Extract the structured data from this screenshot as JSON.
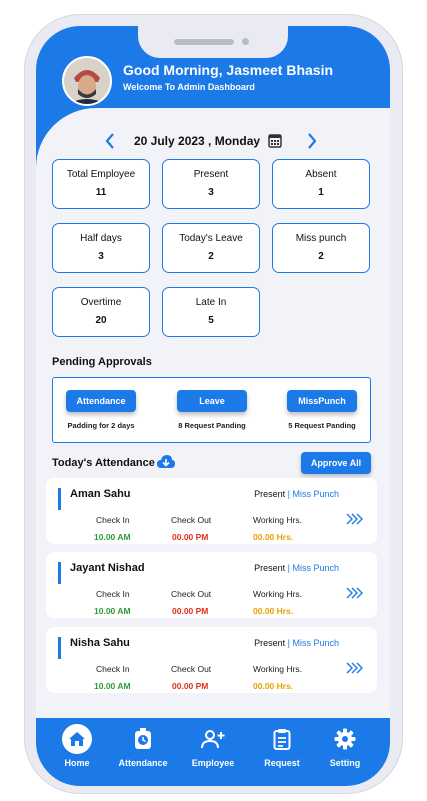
{
  "header": {
    "greeting": "Good Morning, Jasmeet Bhasin",
    "subtitle": "Welcome To Admin Dashboard"
  },
  "date_nav": {
    "date": "20 July 2023 , Monday",
    "prev_icon": "chevron-left-icon",
    "next_icon": "chevron-right-icon",
    "calendar_icon": "calendar-icon"
  },
  "stats": [
    {
      "label": "Total Employee",
      "value": "11"
    },
    {
      "label": "Present",
      "value": "3"
    },
    {
      "label": "Absent",
      "value": "1"
    },
    {
      "label": "Half days",
      "value": "3"
    },
    {
      "label": "Today's Leave",
      "value": "2"
    },
    {
      "label": "Miss punch",
      "value": "2"
    },
    {
      "label": "Overtime",
      "value": "20"
    },
    {
      "label": "Late In",
      "value": "5"
    }
  ],
  "pending": {
    "title": "Pending Approvals",
    "items": [
      {
        "button": "Attendance",
        "caption": "Padding for 2 days"
      },
      {
        "button": "Leave",
        "caption": "8 Request Panding"
      },
      {
        "button": "MissPunch",
        "caption": "5 Request Panding"
      }
    ]
  },
  "attendance": {
    "title": "Today's Attendance",
    "approve_all": "Approve All",
    "labels": {
      "check_in": "Check In",
      "check_out": "Check Out",
      "working": "Working Hrs."
    },
    "rows": [
      {
        "name": "Aman Sahu",
        "status": "Present",
        "sep": "|",
        "tag": "Miss Punch",
        "check_in": "10.00 AM",
        "check_out": "00.00 PM",
        "working": "00.00 Hrs."
      },
      {
        "name": "Jayant Nishad",
        "status": "Present",
        "sep": "|",
        "tag": "Miss Punch",
        "check_in": "10.00 AM",
        "check_out": "00.00 PM",
        "working": "00.00 Hrs."
      },
      {
        "name": "Nisha Sahu",
        "status": "Present",
        "sep": "|",
        "tag": "Miss Punch",
        "check_in": "10.00 AM",
        "check_out": "00.00 PM",
        "working": "00.00 Hrs."
      }
    ]
  },
  "nav": [
    {
      "label": "Home",
      "icon": "home-icon"
    },
    {
      "label": "Attendance",
      "icon": "clock-icon"
    },
    {
      "label": "Employee",
      "icon": "add-user-icon"
    },
    {
      "label": "Request",
      "icon": "clipboard-icon"
    },
    {
      "label": "Setting",
      "icon": "gear-icon"
    }
  ],
  "colors": {
    "accent": "#1b7ae8",
    "check_in": "#2e9b3a",
    "check_out": "#e0301e",
    "working": "#e6a100"
  }
}
